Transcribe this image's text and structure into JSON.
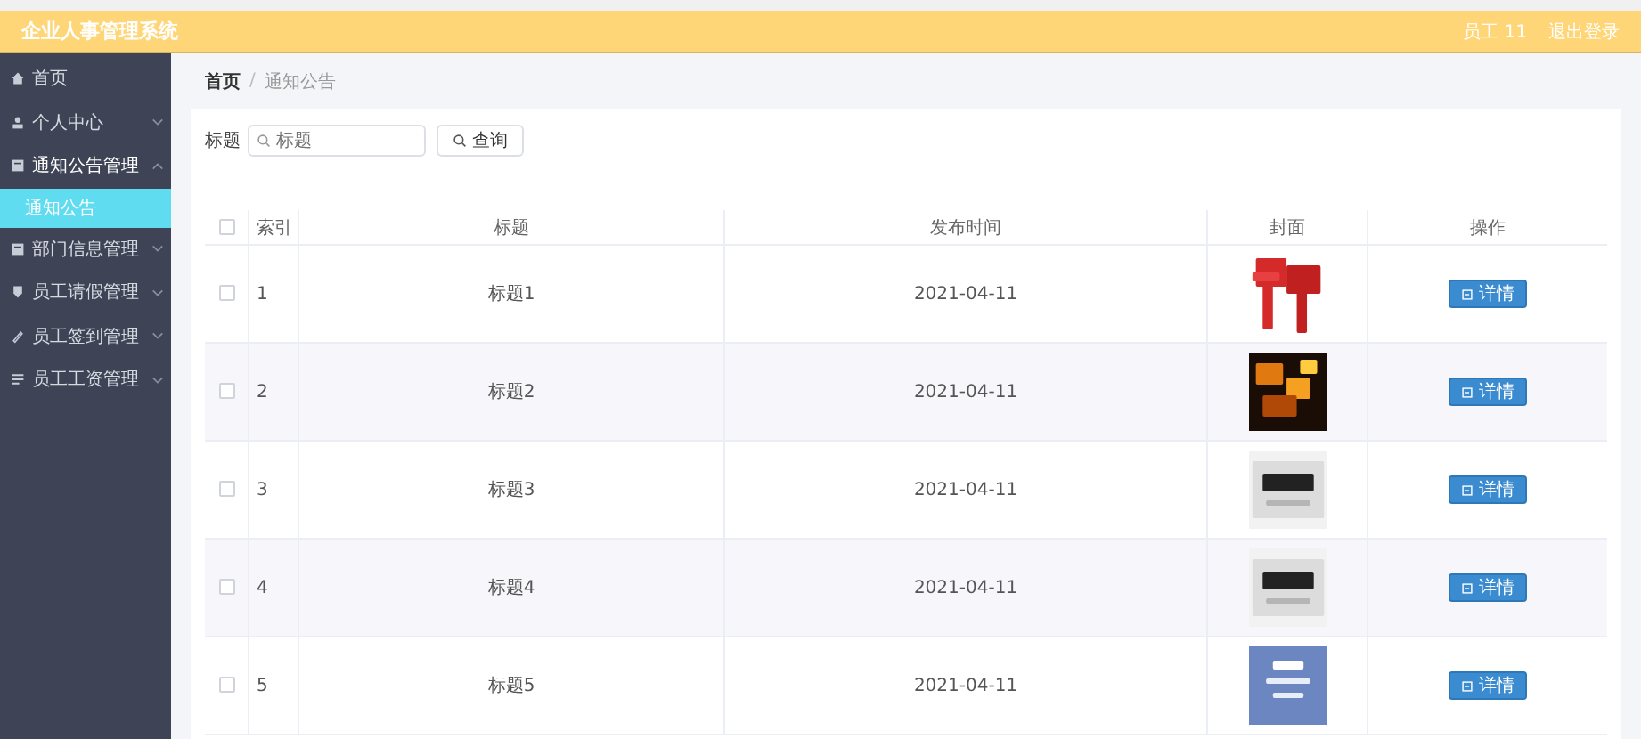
{
  "header": {
    "title": "企业人事管理系统",
    "user": "员工 11",
    "logout": "退出登录"
  },
  "sidebar": {
    "items": [
      {
        "kind": "link",
        "label": "首页"
      },
      {
        "kind": "group",
        "label": "个人中心",
        "expanded": false
      },
      {
        "kind": "group",
        "label": "通知公告管理",
        "expanded": true,
        "children": [
          {
            "label": "通知公告",
            "selected": true
          }
        ]
      },
      {
        "kind": "group",
        "label": "部门信息管理",
        "expanded": false
      },
      {
        "kind": "group",
        "label": "员工请假管理",
        "expanded": false
      },
      {
        "kind": "group",
        "label": "员工签到管理",
        "expanded": false
      },
      {
        "kind": "group",
        "label": "员工工资管理",
        "expanded": false
      }
    ]
  },
  "breadcrumb": {
    "items": [
      "首页",
      "通知公告"
    ],
    "separator": "/"
  },
  "search": {
    "label": "标题",
    "placeholder": "标题",
    "button": "查询"
  },
  "table": {
    "columns": [
      "索引",
      "标题",
      "发布时间",
      "封面",
      "操作"
    ],
    "all_checked": false,
    "rows": [
      {
        "checked": false,
        "index": "1",
        "title": "标题1",
        "date": "2021-04-11",
        "action": "详情"
      },
      {
        "checked": false,
        "index": "2",
        "title": "标题2",
        "date": "2021-04-11",
        "action": "详情"
      },
      {
        "checked": false,
        "index": "3",
        "title": "标题3",
        "date": "2021-04-11",
        "action": "详情"
      },
      {
        "checked": false,
        "index": "4",
        "title": "标题4",
        "date": "2021-04-11",
        "action": "详情"
      },
      {
        "checked": false,
        "index": "5",
        "title": "标题5",
        "date": "2021-04-11",
        "action": "详情"
      }
    ]
  }
}
